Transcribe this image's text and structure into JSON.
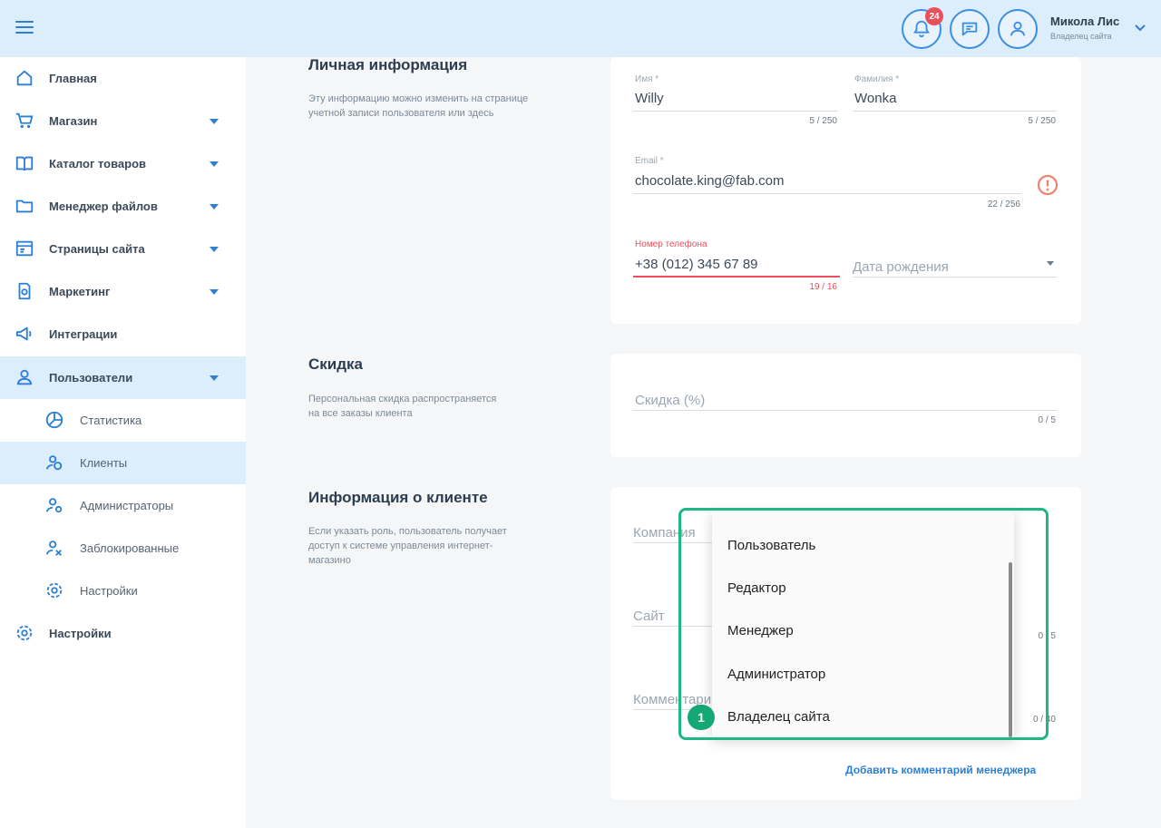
{
  "header": {
    "notifications_count": "24",
    "user_name": "Микола Лис",
    "user_role": "Владелец сайта"
  },
  "sidebar": {
    "items": [
      {
        "label": "Главная",
        "icon": "home-icon",
        "arrow": false
      },
      {
        "label": "Магазин",
        "icon": "cart-icon",
        "arrow": true
      },
      {
        "label": "Каталог товаров",
        "icon": "book-icon",
        "arrow": true
      },
      {
        "label": "Менеджер файлов",
        "icon": "folder-icon",
        "arrow": true
      },
      {
        "label": "Страницы сайта",
        "icon": "pages-icon",
        "arrow": true
      },
      {
        "label": "Маркетинг",
        "icon": "marketing-icon",
        "arrow": true
      },
      {
        "label": "Интеграции",
        "icon": "megaphone-icon",
        "arrow": false
      },
      {
        "label": "Пользователи",
        "icon": "users-icon",
        "arrow": true
      }
    ],
    "subitems": [
      {
        "label": "Статистика",
        "icon": "pie-chart-icon"
      },
      {
        "label": "Клиенты",
        "icon": "client-icon"
      },
      {
        "label": "Администраторы",
        "icon": "admin-icon"
      },
      {
        "label": "Заблокированные",
        "icon": "blocked-user-icon"
      },
      {
        "label": "Настройки",
        "icon": "gear-icon"
      }
    ],
    "settings_label": "Настройки"
  },
  "personal": {
    "title": "Личная информация",
    "description": "Эту информацию можно изменить на странице учетной записи пользователя или здесь",
    "first_name_label": "Имя *",
    "first_name_value": "Willy",
    "first_name_counter": "5 / 250",
    "last_name_label": "Фамилия *",
    "last_name_value": "Wonka",
    "last_name_counter": "5 / 250",
    "email_label": "Email *",
    "email_value": "chocolate.king@fab.com",
    "email_counter": "22 / 256",
    "phone_label": "Номер телефона",
    "phone_value": "+38 (012) 345 67 89",
    "phone_counter": "19 / 16",
    "birth_placeholder": "Дата рождения"
  },
  "discount": {
    "title": "Скидка",
    "description": "Персональная скидка распространяется на все заказы клиента",
    "placeholder": "Скидка (%)",
    "counter": "0 / 5"
  },
  "client_info": {
    "title": "Информация о клиенте",
    "description": "Если указать роль, пользователь получает доступ к системе управления интернет-магазино",
    "company_placeholder": "Компания",
    "site_placeholder": "Сайт",
    "site_counter": "0 / 5",
    "comment_placeholder": "Комментари",
    "comment_counter": "0 / 40",
    "manager_link": "Добавить комментарий менеджера"
  },
  "role_dropdown": {
    "options": [
      "Пользователь",
      "Редактор",
      "Менеджер",
      "Администратор",
      "Владелец сайта"
    ]
  },
  "annotation": {
    "step": "1",
    "color": "#1eb980"
  },
  "colors": {
    "accent": "#2b7fd6",
    "header_bg": "#dcedfb",
    "error": "#e9505a"
  }
}
